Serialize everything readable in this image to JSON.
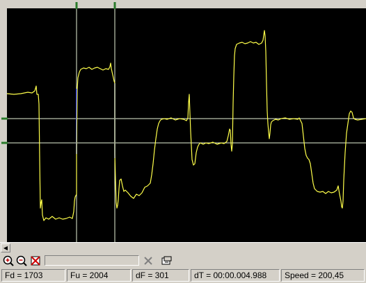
{
  "status": {
    "fd": "Fd = 1703",
    "fu": "Fu = 2004",
    "df": "dF = 301",
    "dt": "dT = 00:00.004.988",
    "speed": "Speed = 200,45"
  },
  "toolbar": {
    "tools": [
      "zoom-in-icon",
      "zoom-out-icon",
      "clear-icon",
      "delete-icon",
      "pointer-hand-icon"
    ]
  },
  "colors": {
    "trace": "#ffff4a",
    "cursor": "#e8f4d8",
    "marker": "#2a7a2a",
    "cursor_segment": "#1a2aff",
    "background": "#000000",
    "chrome": "#d4d0c8"
  }
}
